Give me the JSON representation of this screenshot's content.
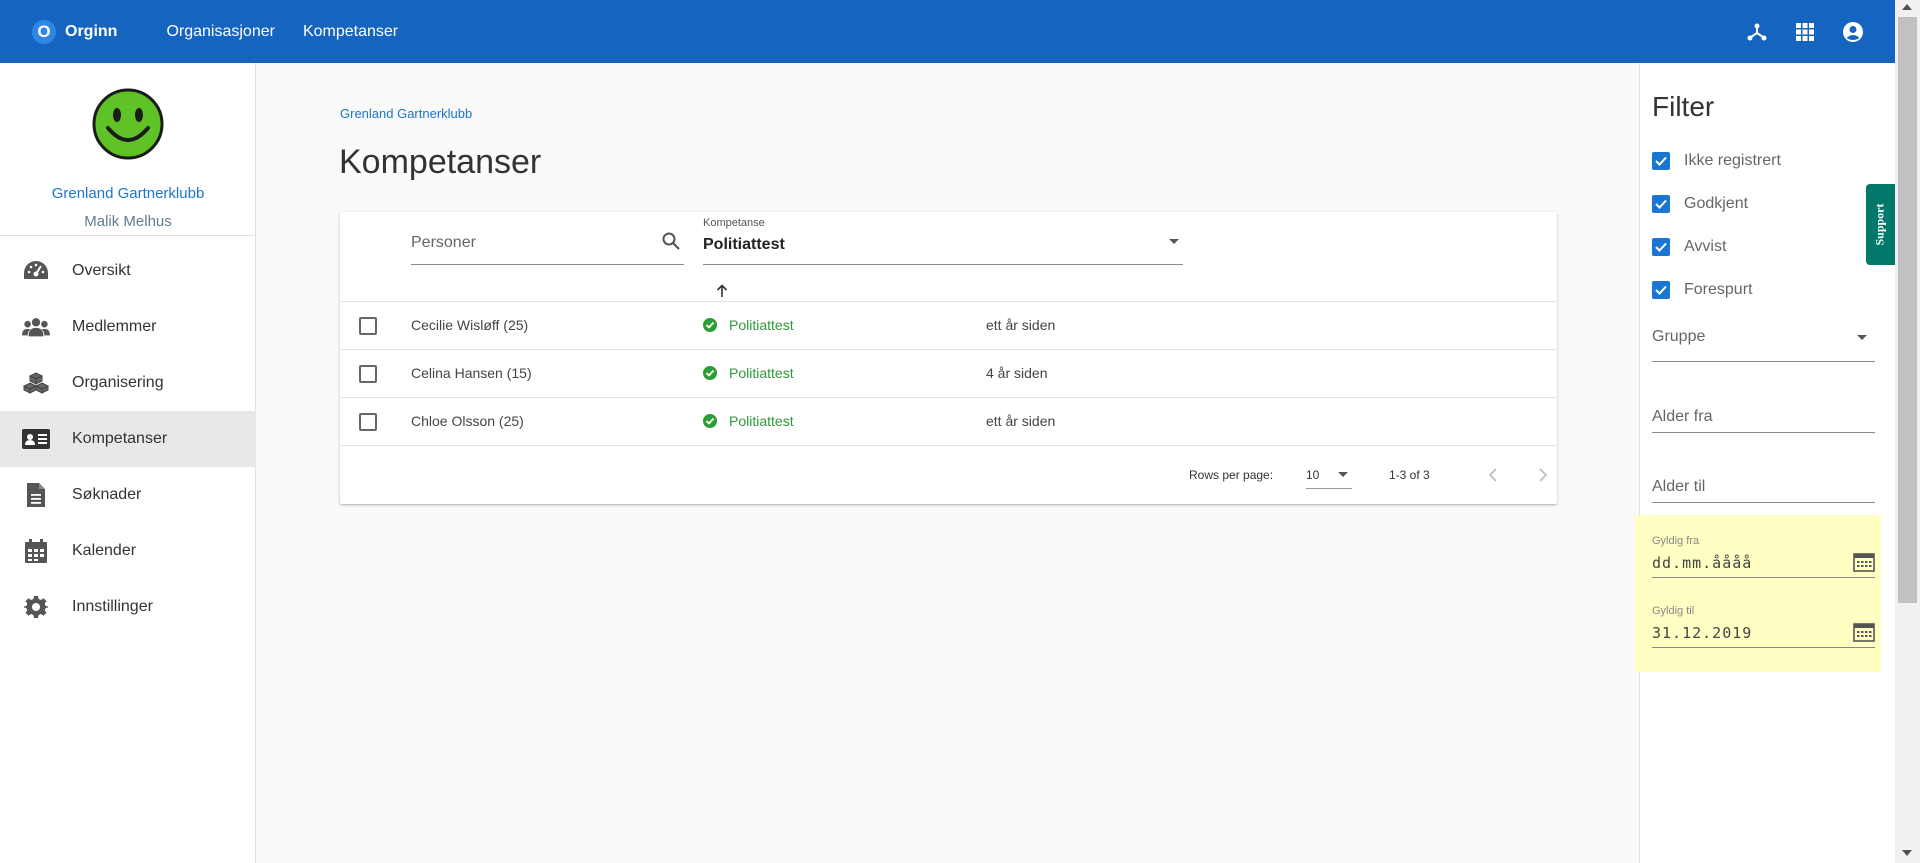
{
  "topbar": {
    "logo_letter": "O",
    "app_name": "Orginn",
    "nav": [
      {
        "label": "Organisasjoner"
      },
      {
        "label": "Kompetanser"
      }
    ],
    "icons": [
      "hierarchy-icon",
      "apps-grid-icon",
      "account-circle-icon"
    ]
  },
  "sidebar": {
    "org_name": "Grenland Gartnerklubb",
    "user_name": "Malik Melhus",
    "items": [
      {
        "label": "Oversikt",
        "icon": "dashboard-gauge-icon"
      },
      {
        "label": "Medlemmer",
        "icon": "people-icon"
      },
      {
        "label": "Organisering",
        "icon": "cubes-icon"
      },
      {
        "label": "Kompetanser",
        "icon": "id-card-icon",
        "active": true
      },
      {
        "label": "Søknader",
        "icon": "document-icon"
      },
      {
        "label": "Kalender",
        "icon": "calendar-icon"
      },
      {
        "label": "Innstillinger",
        "icon": "gear-icon"
      }
    ]
  },
  "main": {
    "breadcrumb": "Grenland Gartnerklubb",
    "title": "Kompetanser",
    "search": {
      "placeholder": "Personer"
    },
    "select": {
      "label": "Kompetanse",
      "value": "Politiattest"
    },
    "rows": [
      {
        "name": "Cecilie Wisløff (25)",
        "status": "Politiattest",
        "time": "ett år siden"
      },
      {
        "name": "Celina Hansen (15)",
        "status": "Politiattest",
        "time": "4 år siden"
      },
      {
        "name": "Chloe Olsson (25)",
        "status": "Politiattest",
        "time": "ett år siden"
      }
    ],
    "pagination": {
      "rows_per_page_label": "Rows per page:",
      "rows_per_page": "10",
      "range": "1-3 of 3"
    }
  },
  "filter": {
    "title": "Filter",
    "checks": [
      {
        "label": "Ikke registrert",
        "checked": true
      },
      {
        "label": "Godkjent",
        "checked": true
      },
      {
        "label": "Avvist",
        "checked": true
      },
      {
        "label": "Forespurt",
        "checked": true
      }
    ],
    "gruppe_label": "Gruppe",
    "alder_fra_label": "Alder fra",
    "alder_til_label": "Alder til",
    "gyldig_fra_label": "Gyldig fra",
    "gyldig_fra_value": "dd.mm.åååå",
    "gyldig_til_label": "Gyldig til",
    "gyldig_til_value": "31.12.2019"
  },
  "support_label": "Support",
  "colors": {
    "primary": "#1565c0",
    "link": "#1976d2",
    "success": "#2e9c3a",
    "support": "#00796b",
    "highlight": "#ffffc4"
  }
}
